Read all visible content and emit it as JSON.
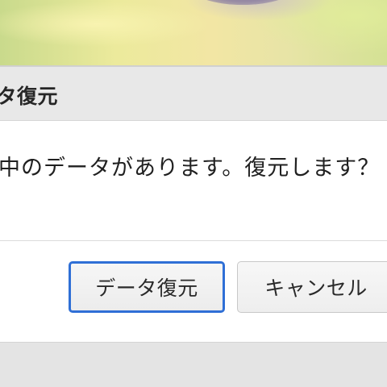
{
  "dialog": {
    "title": "ータ復元",
    "message": "集中のデータがあります。復元します？",
    "buttons": {
      "restore_label": "データ復元",
      "cancel_label": "キャンセル"
    }
  },
  "colors": {
    "focus_ring": "#2f6fd6",
    "header_bg": "#e8e8e8",
    "dialog_bg": "#ffffff"
  }
}
